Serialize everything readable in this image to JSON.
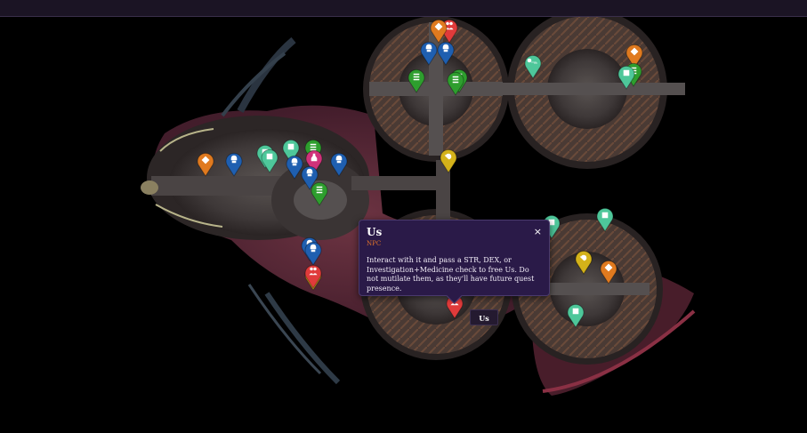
{
  "popup": {
    "title": "Us",
    "category": "NPC",
    "description": "Interact with it and pass a STR, DEX, or Investigation+Medicine check to free Us. Do not mutilate them, as they'll have future quest presence.",
    "close_label": "×"
  },
  "tooltip": {
    "label": "Us"
  },
  "colors": {
    "npc": "#e03b3b",
    "quest": "#2e9e2e",
    "container": "#4ec79a",
    "enemy": "#1f5fb0",
    "chest": "#e07a1f",
    "waypoint": "#d4b21a",
    "item": "#d0327a",
    "popup_bg": "#2a1a48"
  },
  "markers": [
    {
      "name": "marker-chest-1",
      "color": "chest",
      "icon": "diamond-icon"
    },
    {
      "name": "marker-enemy-1",
      "color": "enemy",
      "icon": "skull-icon"
    },
    {
      "name": "marker-container-1",
      "color": "container",
      "icon": "box-icon"
    },
    {
      "name": "marker-container-2",
      "color": "container",
      "icon": "box-icon"
    },
    {
      "name": "marker-container-3",
      "color": "container",
      "icon": "box-icon"
    },
    {
      "name": "marker-enemy-2",
      "color": "enemy",
      "icon": "skull-icon"
    },
    {
      "name": "marker-quest-1",
      "color": "quest",
      "icon": "quest-icon"
    },
    {
      "name": "marker-item-1",
      "color": "item",
      "icon": "potion-icon"
    },
    {
      "name": "marker-enemy-3",
      "color": "enemy",
      "icon": "skull-icon"
    },
    {
      "name": "marker-enemy-4",
      "color": "enemy",
      "icon": "skull-icon"
    },
    {
      "name": "marker-quest-2",
      "color": "quest",
      "icon": "quest-icon"
    },
    {
      "name": "marker-enemy-5",
      "color": "enemy",
      "icon": "skull-icon"
    },
    {
      "name": "marker-waypoint-1",
      "color": "waypoint",
      "icon": "waypoint-icon"
    },
    {
      "name": "marker-quest-3",
      "color": "quest",
      "icon": "quest-icon"
    },
    {
      "name": "marker-npc-1",
      "color": "npc",
      "icon": "npc-icon"
    },
    {
      "name": "marker-chest-2",
      "color": "chest",
      "icon": "diamond-icon"
    },
    {
      "name": "marker-enemy-6",
      "color": "enemy",
      "icon": "skull-icon"
    },
    {
      "name": "marker-enemy-7",
      "color": "enemy",
      "icon": "skull-icon"
    },
    {
      "name": "marker-waypoint-2",
      "color": "waypoint",
      "icon": "waypoint-icon"
    },
    {
      "name": "marker-quest-4",
      "color": "quest",
      "icon": "quest-icon"
    },
    {
      "name": "marker-quest-5",
      "color": "quest",
      "icon": "quest-icon"
    },
    {
      "name": "marker-container-4",
      "color": "container",
      "icon": "key-icon"
    },
    {
      "name": "marker-chest-3",
      "color": "chest",
      "icon": "diamond-icon"
    },
    {
      "name": "marker-quest-6",
      "color": "quest",
      "icon": "quest-icon"
    },
    {
      "name": "marker-container-5",
      "color": "container",
      "icon": "box-icon"
    },
    {
      "name": "marker-waypoint-3",
      "color": "waypoint",
      "icon": "waypoint-icon"
    },
    {
      "name": "marker-enemy-8",
      "color": "enemy",
      "icon": "skull-icon"
    },
    {
      "name": "marker-npc-2",
      "color": "npc",
      "icon": "npc-icon"
    },
    {
      "name": "marker-container-6",
      "color": "container",
      "icon": "box-icon"
    },
    {
      "name": "marker-container-7",
      "color": "container",
      "icon": "box-icon"
    },
    {
      "name": "marker-waypoint-4",
      "color": "waypoint",
      "icon": "waypoint-icon"
    },
    {
      "name": "marker-chest-4",
      "color": "chest",
      "icon": "diamond-icon"
    },
    {
      "name": "marker-waypoint-5",
      "color": "waypoint",
      "icon": "waypoint-icon"
    },
    {
      "name": "marker-container-8",
      "color": "container",
      "icon": "box-icon"
    },
    {
      "name": "marker-npc-us",
      "color": "npc",
      "icon": "npc-icon"
    }
  ]
}
